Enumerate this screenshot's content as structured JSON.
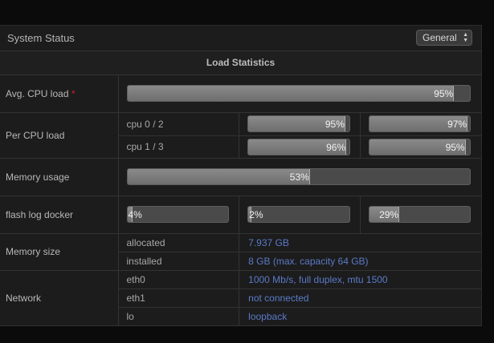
{
  "panel": {
    "title": "System Status",
    "view_select": "General"
  },
  "section": {
    "title": "Load Statistics"
  },
  "rows": {
    "avg_cpu": {
      "label": "Avg. CPU load",
      "required": "*",
      "value": 95,
      "text": "95%"
    },
    "per_cpu": {
      "label": "Per CPU load",
      "lines": [
        {
          "name": "cpu 0 / 2",
          "a": 95,
          "a_text": "95%",
          "b": 97,
          "b_text": "97%"
        },
        {
          "name": "cpu 1 / 3",
          "a": 96,
          "a_text": "96%",
          "b": 95,
          "b_text": "95%"
        }
      ]
    },
    "memory_usage": {
      "label": "Memory usage",
      "value": 53,
      "text": "53%"
    },
    "flash": {
      "label": "flash log docker",
      "flash": 4,
      "flash_text": "4%",
      "log": 2,
      "log_text": "2%",
      "docker": 29,
      "docker_text": "29%"
    },
    "memory_size": {
      "label": "Memory size",
      "allocated_label": "allocated",
      "allocated_value": "7.937 GB",
      "installed_label": "installed",
      "installed_value": "8 GB (max. capacity 64 GB)"
    },
    "network": {
      "label": "Network",
      "eth0_label": "eth0",
      "eth0_value": "1000 Mb/s, full duplex, mtu 1500",
      "eth1_label": "eth1",
      "eth1_value": "not connected",
      "lo_label": "lo",
      "lo_value": "loopback"
    }
  }
}
